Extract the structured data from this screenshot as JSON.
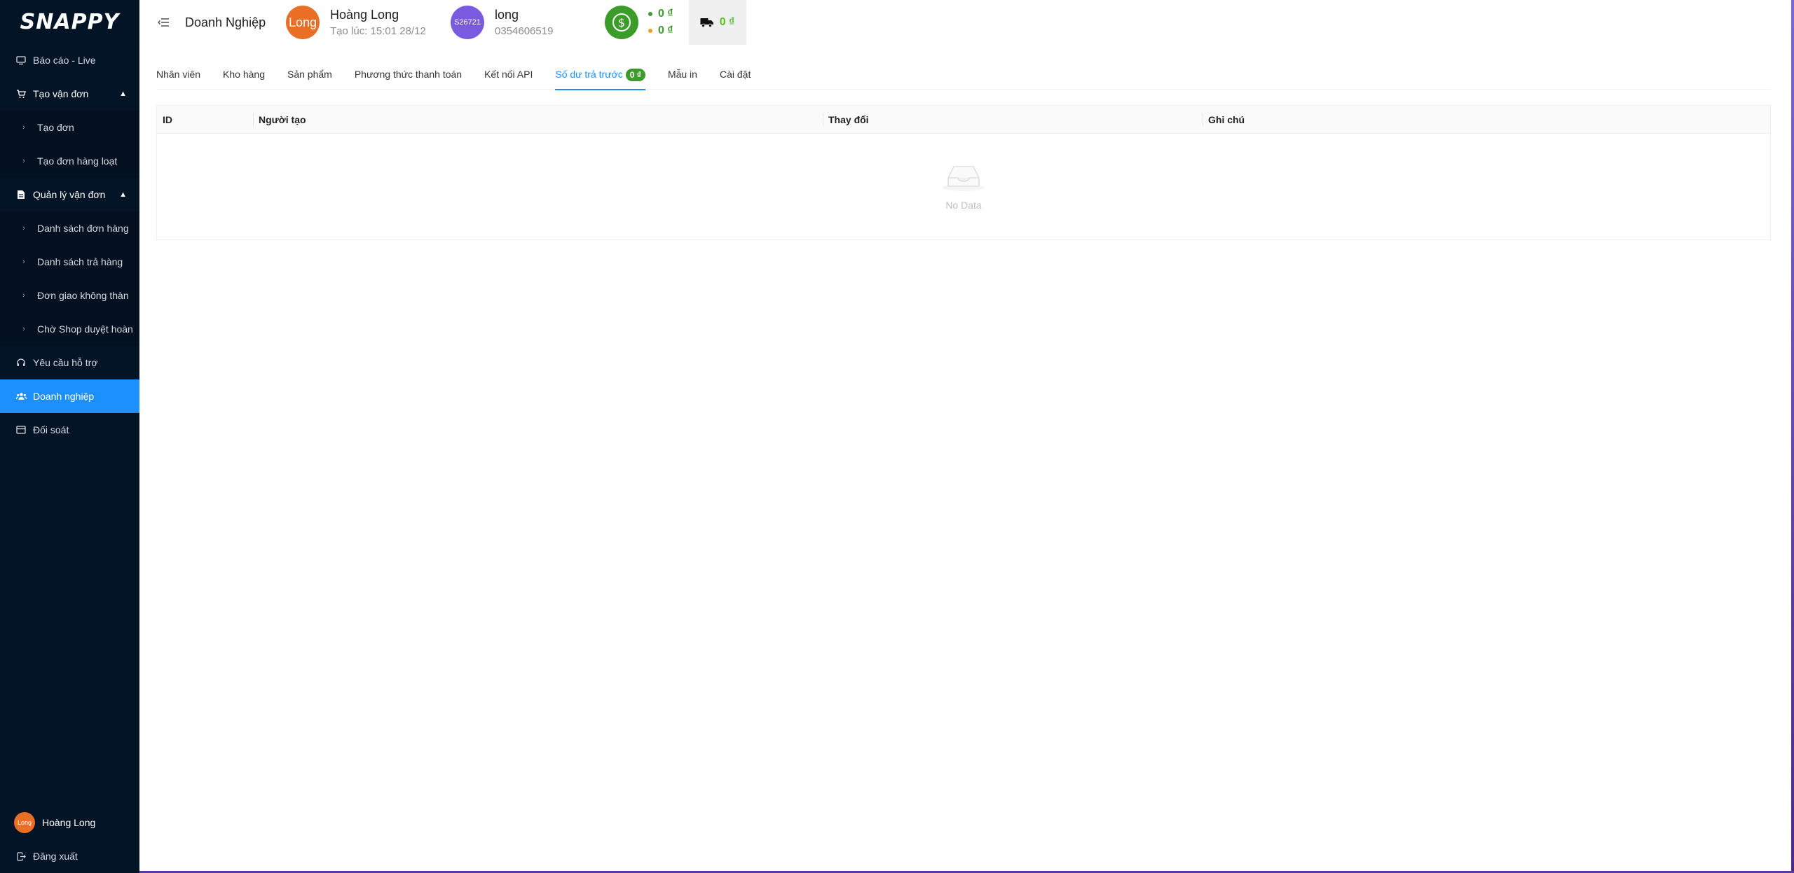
{
  "brand": {
    "logo_text": "SNAPPY"
  },
  "sidebar": {
    "items": [
      {
        "label": "Báo cáo - Live",
        "icon": "monitor-icon"
      },
      {
        "label": "Tạo vận đơn",
        "icon": "cart-icon"
      },
      {
        "label": "Tạo đơn"
      },
      {
        "label": "Tạo đơn hàng loạt"
      },
      {
        "label": "Quản lý vận đơn",
        "icon": "document-icon"
      },
      {
        "label": "Danh sách đơn hàng"
      },
      {
        "label": "Danh sách trả hàng"
      },
      {
        "label": "Đơn giao không thàn"
      },
      {
        "label": "Chờ Shop duyệt hoàn"
      },
      {
        "label": "Yêu cầu hỗ trợ",
        "icon": "headset-icon"
      },
      {
        "label": "Doanh nghiệp",
        "icon": "team-icon"
      },
      {
        "label": "Đối soát",
        "icon": "card-icon"
      }
    ],
    "footer": {
      "user_name": "Hoàng Long",
      "user_avatar_text": "Long",
      "logout_label": "Đăng xuất"
    }
  },
  "header": {
    "page_title": "Doanh Nghiệp",
    "user": {
      "avatar_text": "Long",
      "name": "Hoàng Long",
      "created": "Tạo lúc: 15:01 28/12"
    },
    "account": {
      "avatar_text": "S26721",
      "name": "long",
      "phone": "0354606519"
    },
    "wallet": {
      "balance_1": "0 ₫",
      "balance_2": "0 ₫",
      "dot_color_1": "#3b9c2a",
      "dot_color_2": "#f0a020"
    },
    "shipping": {
      "value": "0 ₫"
    }
  },
  "tabs": [
    {
      "label": "Nhân viên"
    },
    {
      "label": "Kho hàng"
    },
    {
      "label": "Sản phẩm"
    },
    {
      "label": "Phương thức thanh toán"
    },
    {
      "label": "Kết nối API"
    },
    {
      "label": "Số dư trả trước",
      "badge": "0 ₫",
      "active": true
    },
    {
      "label": "Mẫu in"
    },
    {
      "label": "Cài đặt"
    }
  ],
  "table": {
    "columns": [
      "ID",
      "Người tạo",
      "Thay đổi",
      "Ghi chú"
    ],
    "rows": [],
    "empty_text": "No Data"
  },
  "colors": {
    "sidebar_bg": "#041427",
    "active": "#1d90ff",
    "money_green": "#3b9c2a",
    "ship_value": "#56c21f"
  }
}
